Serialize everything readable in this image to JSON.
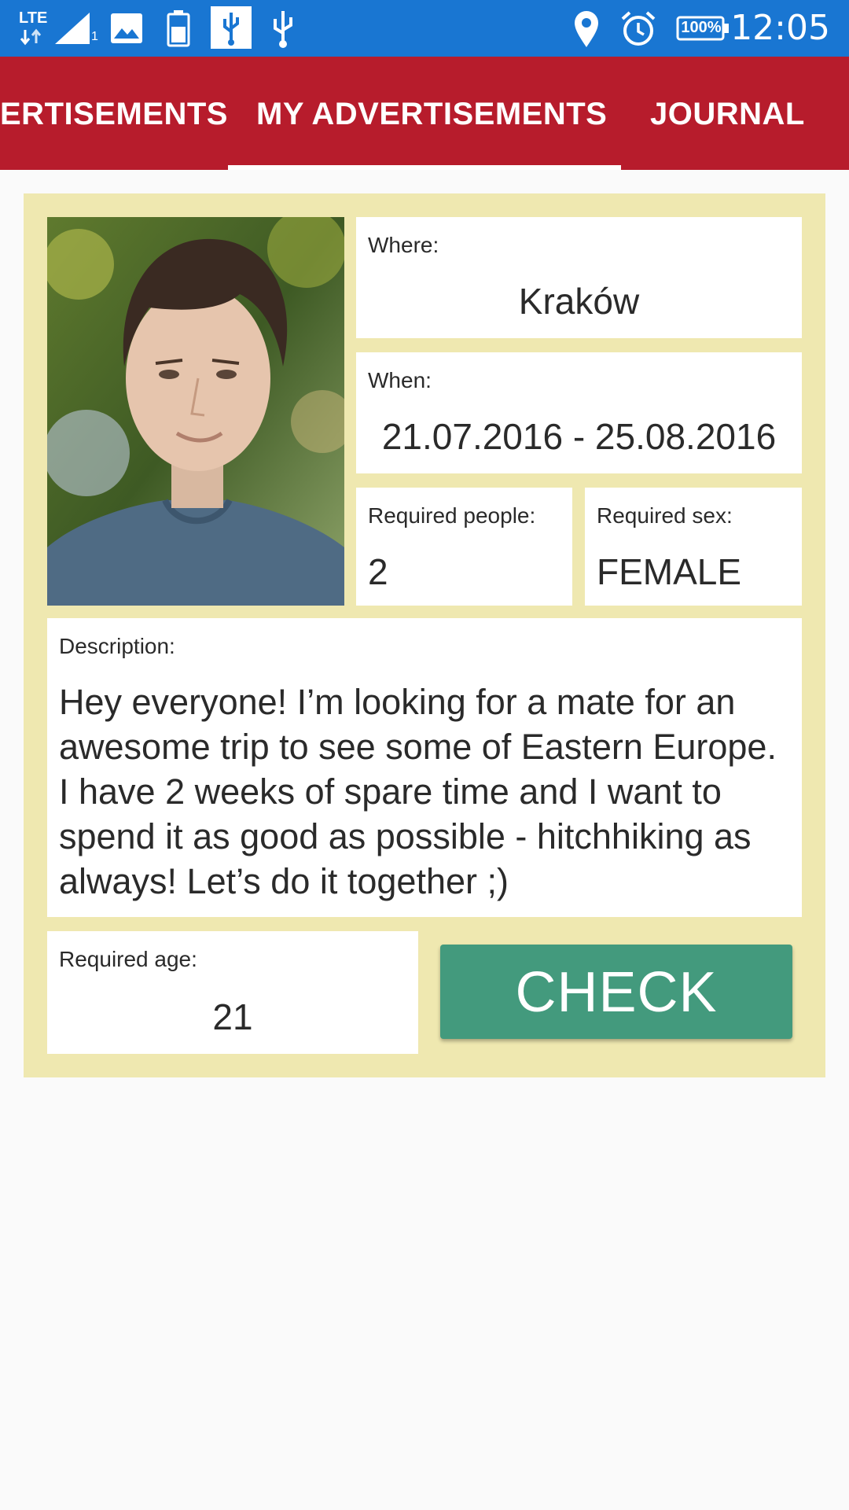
{
  "status_bar": {
    "network": "LTE",
    "sim_slot": "1",
    "battery": "100%",
    "time": "12:05",
    "icons": [
      "lte-icon",
      "signal-icon",
      "image-icon",
      "battery-saver-icon",
      "usb-icon",
      "usb-icon",
      "location-icon",
      "alarm-icon",
      "battery-icon"
    ]
  },
  "tabs": [
    {
      "label": "ADVERTISEMENTS",
      "visible_text": "ERTISEMENTS",
      "active": false
    },
    {
      "label": "MY ADVERTISEMENTS",
      "active": true
    },
    {
      "label": "JOURNAL",
      "active": false
    }
  ],
  "colors": {
    "status_bar": "#1976d2",
    "tab_bar": "#b71c2c",
    "card": "#efe8b0",
    "check_button": "#439a7d"
  },
  "ad": {
    "where_label": "Where:",
    "where_value": "Kraków",
    "when_label": "When:",
    "when_value": "21.07.2016 - 25.08.2016",
    "people_label": "Required people:",
    "people_value": "2",
    "sex_label": "Required sex:",
    "sex_value": "FEMALE",
    "description_label": "Description:",
    "description_value": "Hey everyone! I’m looking for a mate for an awesome trip to see some of Eastern Europe. I have 2 weeks of spare time and I want to spend it as good as possible - hitchhiking as always! Let’s do it together ;)",
    "age_label": "Required age:",
    "age_value": "21",
    "check_label": "CHECK"
  }
}
